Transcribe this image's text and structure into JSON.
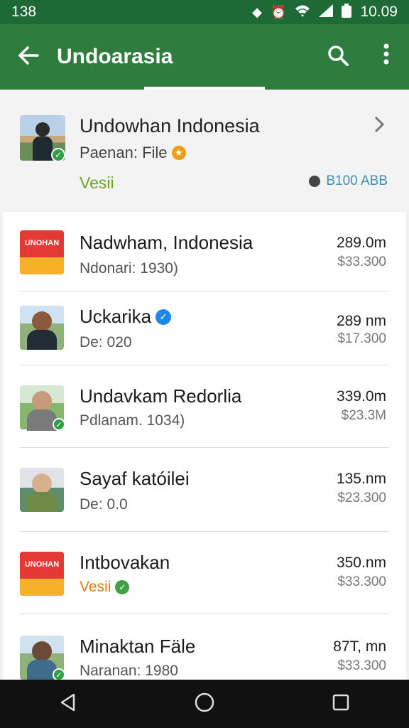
{
  "status_bar": {
    "time_left": "138",
    "time_right": "10.09"
  },
  "app_bar": {
    "title": "Undoarasia"
  },
  "header": {
    "title": "Undowhan Indonesia",
    "subtitle": "Paenan: File",
    "tag": "Vesii",
    "meta": "B100 ABB"
  },
  "items": [
    {
      "title": "Nadwham, Indonesia",
      "subtitle": "Ndonari: 1930)",
      "distance": "289.0m",
      "price": "$33.300",
      "logo_text": "UNOHAN"
    },
    {
      "title": "Uckarika",
      "subtitle": "De: 020",
      "distance": "289 nm",
      "price": "$17.300"
    },
    {
      "title": "Undavkam Redorlia",
      "subtitle": "Pdlanam. 1034)",
      "distance": "339.0m",
      "price": "$23.3M"
    },
    {
      "title": "Sayaf katóilei",
      "subtitle": "De: 0.0",
      "distance": "135.nm",
      "price": "$23.300"
    },
    {
      "title": "Intbovakan",
      "subtitle": "Vesii",
      "distance": "350.nm",
      "price": "$33.300",
      "logo_text": "UNOHAN"
    },
    {
      "title": "Minaktan Fäle",
      "subtitle": "Naranan: 1980",
      "distance": "87T, mn",
      "price": "$33.300"
    }
  ],
  "colors": {
    "status_bar": "#1e6a36",
    "app_bar": "#2e7d3f",
    "accent_green": "#6aa52a",
    "nav_bar": "#111111"
  },
  "icons": {
    "back": "arrow-back-icon",
    "search": "search-icon",
    "more": "more-vert-icon"
  }
}
